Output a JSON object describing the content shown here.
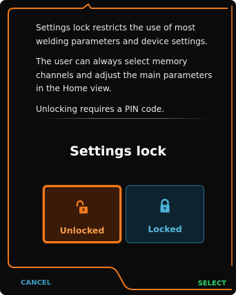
{
  "info": {
    "paragraph1": "Settings lock restricts the use of most welding parameters and device settings.",
    "paragraph2": "The user can always select memory channels and adjust the main parameters in the Home view.",
    "paragraph3": "Unlocking requires a PIN code."
  },
  "title": "Settings lock",
  "options": {
    "unlocked": {
      "label": "Unlocked",
      "icon": "unlocked-padlock-icon",
      "selected": true
    },
    "locked": {
      "label": "Locked",
      "icon": "locked-padlock-icon",
      "selected": false
    }
  },
  "footer": {
    "cancel_label": "CANCEL",
    "select_label": "SELECT"
  },
  "colors": {
    "accent_orange": "#f07a1e",
    "accent_blue": "#3f9ec2",
    "select_green": "#2fd46a",
    "background": "#0b0b0b"
  }
}
